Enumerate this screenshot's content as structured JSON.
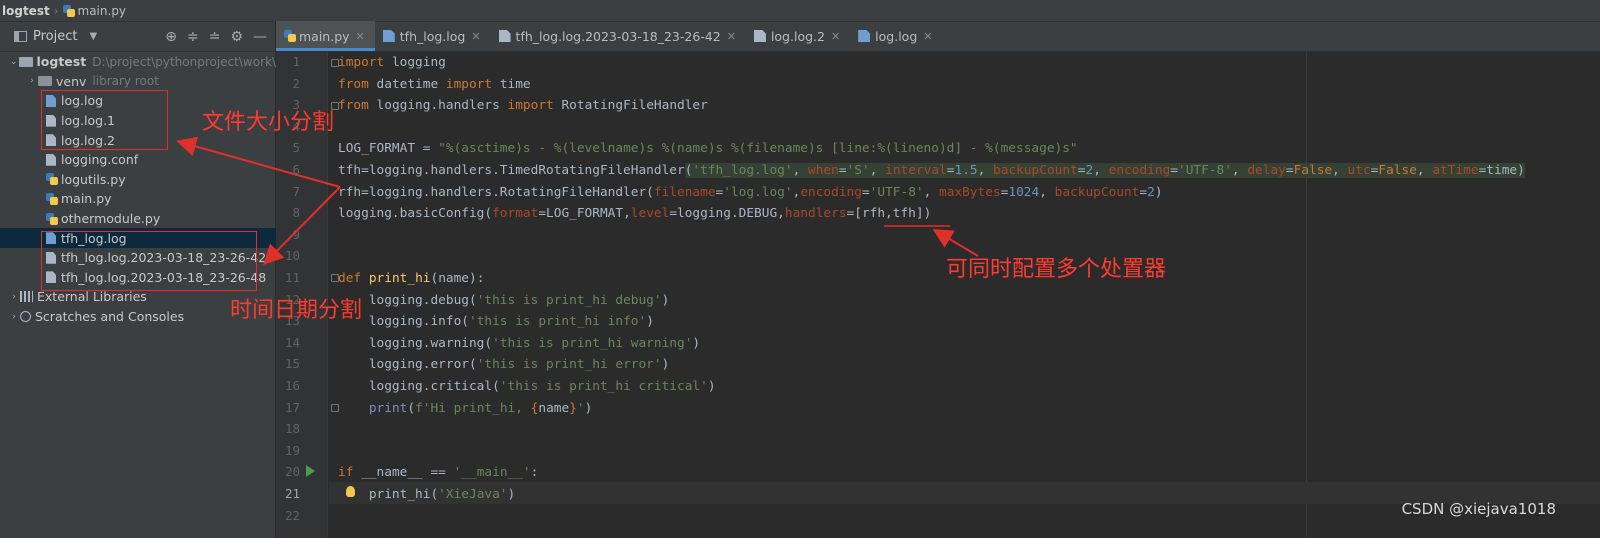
{
  "breadcrumb": {
    "project": "logtest",
    "file": "main.py"
  },
  "panel": {
    "title": "Project"
  },
  "tree": {
    "root_name": "logtest",
    "root_path": "D:\\project\\pythonproject\\work\\",
    "venv_name": "venv",
    "venv_hint": "library root",
    "files": [
      "log.log",
      "log.log.1",
      "log.log.2",
      "logging.conf",
      "logutils.py",
      "main.py",
      "othermodule.py",
      "tfh_log.log",
      "tfh_log.log.2023-03-18_23-26-42",
      "tfh_log.log.2023-03-18_23-26-48"
    ],
    "external_libraries": "External Libraries",
    "scratches": "Scratches and Consoles"
  },
  "tabs": [
    "main.py",
    "tfh_log.log",
    "tfh_log.log.2023-03-18_23-26-42",
    "log.log.2",
    "log.log"
  ],
  "line_numbers": [
    "1",
    "2",
    "3",
    "4",
    "5",
    "6",
    "7",
    "8",
    "9",
    "10",
    "11",
    "12",
    "13",
    "14",
    "15",
    "16",
    "17",
    "18",
    "19",
    "20",
    "21",
    "22"
  ],
  "annotations": {
    "size_split": "文件大小分割",
    "time_split": "时间日期分割",
    "multi_handlers": "可同时配置多个处置器"
  },
  "watermark": "CSDN @xiejava1018",
  "colors": {
    "background": "#2b2b2b",
    "keyword": "#cc7832",
    "string": "#6a8759",
    "number": "#6897bb",
    "annotation": "#ff3b30",
    "selection": "#0d293e"
  }
}
